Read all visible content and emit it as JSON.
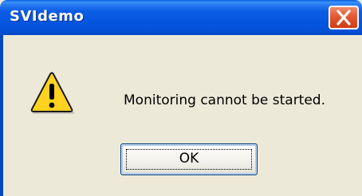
{
  "window": {
    "title": "SVIdemo"
  },
  "dialog": {
    "icon": "warning-icon",
    "message": "Monitoring cannot be started.",
    "ok_label": "OK"
  },
  "colors": {
    "titlebar": "#0554de",
    "close_button": "#e35a32",
    "dialog_background": "#ece9d8",
    "warning_fill": "#ffd21f"
  }
}
